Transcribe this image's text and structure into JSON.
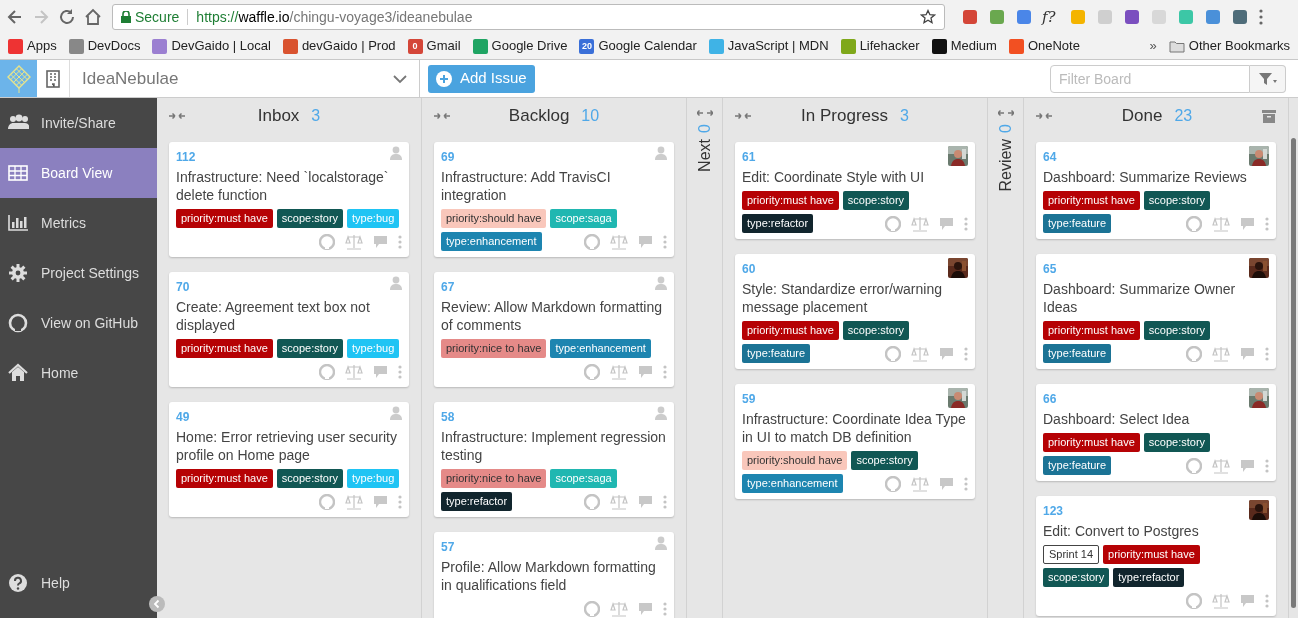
{
  "browser": {
    "secure_label": "Secure",
    "url_scheme": "https://",
    "url_host": "waffle.io",
    "url_path": "/chingu-voyage3/ideanebulae",
    "extension_glyph": "f?",
    "bookmarks": [
      {
        "label": "Apps"
      },
      {
        "label": "DevDocs"
      },
      {
        "label": "DevGaido | Local"
      },
      {
        "label": "devGaido | Prod"
      },
      {
        "label": "Gmail",
        "icon_text": "0"
      },
      {
        "label": "Google Drive"
      },
      {
        "label": "Google Calendar",
        "icon_text": "20"
      },
      {
        "label": "JavaScript | MDN"
      },
      {
        "label": "Lifehacker"
      },
      {
        "label": "Medium"
      },
      {
        "label": "OneNote"
      }
    ],
    "overflow": "»",
    "other_bookmarks": "Other Bookmarks"
  },
  "header": {
    "project": "IdeaNebulae",
    "add_issue": "Add Issue",
    "filter_placeholder": "Filter Board"
  },
  "sidebar": {
    "items": [
      {
        "label": "Invite/Share",
        "selected": false
      },
      {
        "label": "Board View",
        "selected": true
      },
      {
        "label": "Metrics",
        "selected": false
      },
      {
        "label": "Project Settings",
        "selected": false
      },
      {
        "label": "View on GitHub",
        "selected": false
      },
      {
        "label": "Home",
        "selected": false
      }
    ],
    "help": "Help"
  },
  "columns": [
    {
      "title": "Inbox",
      "count": "3",
      "collapsed": false,
      "archive": false,
      "cards": [
        {
          "number": "112",
          "title": "Infrastructure: Need `localstorage` delete function",
          "assigned": false,
          "labels": [
            {
              "kind": "label",
              "text": "priority:must have",
              "color": "#b60205"
            },
            {
              "kind": "label",
              "text": "scope:story",
              "color": "#115754"
            },
            {
              "kind": "label",
              "text": "type:bug",
              "color": "#1fc4f4"
            }
          ]
        },
        {
          "number": "70",
          "title": "Create: Agreement text box not displayed",
          "assigned": false,
          "labels": [
            {
              "kind": "label",
              "text": "priority:must have",
              "color": "#b60205"
            },
            {
              "kind": "label",
              "text": "scope:story",
              "color": "#115754"
            },
            {
              "kind": "label",
              "text": "type:bug",
              "color": "#1fc4f4"
            }
          ]
        },
        {
          "number": "49",
          "title": "Home: Error retrieving user security profile on Home page",
          "assigned": false,
          "labels": [
            {
              "kind": "label",
              "text": "priority:must have",
              "color": "#b60205"
            },
            {
              "kind": "label",
              "text": "scope:story",
              "color": "#115754"
            },
            {
              "kind": "label",
              "text": "type:bug",
              "color": "#1fc4f4"
            }
          ]
        }
      ]
    },
    {
      "title": "Backlog",
      "count": "10",
      "collapsed": false,
      "archive": false,
      "cards": [
        {
          "number": "69",
          "title": "Infrastructure: Add TravisCI integration",
          "assigned": false,
          "labels": [
            {
              "kind": "label",
              "text": "priority:should have",
              "color": "#f9c7bb"
            },
            {
              "kind": "label",
              "text": "scope:saga",
              "color": "#20b7b1"
            },
            {
              "kind": "label",
              "text": "type:enhancement",
              "color": "#1d85b0"
            }
          ]
        },
        {
          "number": "67",
          "title": "Review: Allow Markdown formatting of comments",
          "assigned": false,
          "labels": [
            {
              "kind": "label",
              "text": "priority:nice to have",
              "color": "#e58a88"
            },
            {
              "kind": "label",
              "text": "type:enhancement",
              "color": "#1d85b0"
            }
          ]
        },
        {
          "number": "58",
          "title": "Infrastructure: Implement regression testing",
          "assigned": false,
          "labels": [
            {
              "kind": "label",
              "text": "priority:nice to have",
              "color": "#e58a88"
            },
            {
              "kind": "label",
              "text": "scope:saga",
              "color": "#20b7b1"
            },
            {
              "kind": "label",
              "text": "type:refactor",
              "color": "#11252d"
            }
          ]
        },
        {
          "number": "57",
          "title": "Profile: Allow Markdown formatting in qualifications field",
          "assigned": false
        }
      ]
    },
    {
      "title": "Next",
      "count": "0",
      "collapsed": true
    },
    {
      "title": "In Progress",
      "count": "3",
      "collapsed": false,
      "archive": false,
      "cards": [
        {
          "number": "61",
          "title": "Edit: Coordinate Style with UI",
          "assigned": true,
          "labels": [
            {
              "kind": "label",
              "text": "priority:must have",
              "color": "#b60205"
            },
            {
              "kind": "label",
              "text": "scope:story",
              "color": "#115754"
            },
            {
              "kind": "label",
              "text": "type:refactor",
              "color": "#11252d"
            }
          ]
        },
        {
          "number": "60",
          "title": "Style: Standardize error/warning message placement",
          "assigned": true,
          "labels": [
            {
              "kind": "label",
              "text": "priority:must have",
              "color": "#b60205"
            },
            {
              "kind": "label",
              "text": "scope:story",
              "color": "#115754"
            },
            {
              "kind": "label",
              "text": "type:feature",
              "color": "#1b7395"
            }
          ]
        },
        {
          "number": "59",
          "title": "Infrastructure: Coordinate Idea Type in UI to match DB definition",
          "assigned": true,
          "labels": [
            {
              "kind": "label",
              "text": "priority:should have",
              "color": "#f9c7bb"
            },
            {
              "kind": "label",
              "text": "scope:story",
              "color": "#115754"
            },
            {
              "kind": "label",
              "text": "type:enhancement",
              "color": "#1d85b0"
            }
          ]
        }
      ]
    },
    {
      "title": "Review",
      "count": "0",
      "collapsed": true
    },
    {
      "title": "Done",
      "count": "23",
      "collapsed": false,
      "archive": true,
      "cards": [
        {
          "number": "64",
          "title": "Dashboard: Summarize Reviews",
          "assigned": true,
          "labels": [
            {
              "kind": "label",
              "text": "priority:must have",
              "color": "#b60205"
            },
            {
              "kind": "label",
              "text": "scope:story",
              "color": "#115754"
            },
            {
              "kind": "label",
              "text": "type:feature",
              "color": "#1b7395"
            }
          ]
        },
        {
          "number": "65",
          "title": "Dashboard: Summarize Owner Ideas",
          "assigned": true,
          "labels": [
            {
              "kind": "label",
              "text": "priority:must have",
              "color": "#b60205"
            },
            {
              "kind": "label",
              "text": "scope:story",
              "color": "#115754"
            },
            {
              "kind": "label",
              "text": "type:feature",
              "color": "#1b7395"
            }
          ]
        },
        {
          "number": "66",
          "title": "Dashboard: Select Idea",
          "assigned": true,
          "labels": [
            {
              "kind": "label",
              "text": "priority:must have",
              "color": "#b60205"
            },
            {
              "kind": "label",
              "text": "scope:story",
              "color": "#115754"
            },
            {
              "kind": "label",
              "text": "type:feature",
              "color": "#1b7395"
            }
          ]
        },
        {
          "number": "123",
          "title": "Edit: Convert to Postgres",
          "assigned": true,
          "labels": [
            {
              "kind": "milestone",
              "text": "Sprint 14"
            },
            {
              "kind": "label",
              "text": "priority:must have",
              "color": "#b60205"
            },
            {
              "kind": "label",
              "text": "scope:story",
              "color": "#115754"
            },
            {
              "kind": "label",
              "text": "type:refactor",
              "color": "#11252d"
            }
          ]
        }
      ]
    }
  ]
}
